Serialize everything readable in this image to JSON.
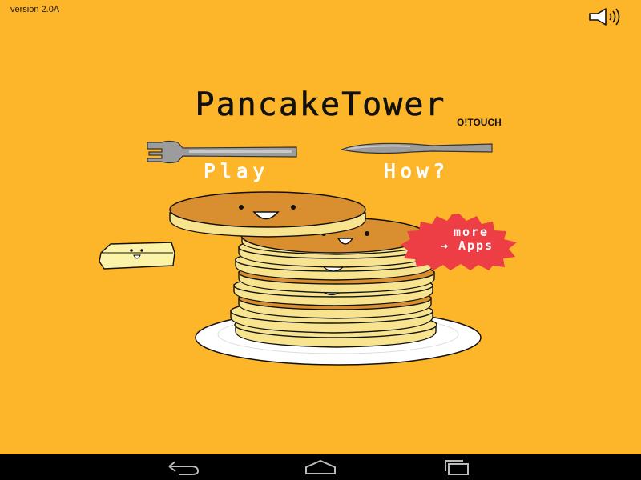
{
  "header": {
    "version": "version 2.0A",
    "sound_icon": "speaker-icon"
  },
  "title": {
    "main": "PancakeTower",
    "brand": "O!TOUCH"
  },
  "menu": {
    "play_label": "Play",
    "how_label": "How?",
    "play_icon": "fork-icon",
    "how_icon": "knife-icon"
  },
  "promo": {
    "line1": "more",
    "line2": "Apps",
    "arrow": "→"
  },
  "navbar": {
    "back_icon": "back-icon",
    "home_icon": "home-icon",
    "recents_icon": "recents-icon"
  },
  "colors": {
    "background": "#FDB52A",
    "pancake": "#F8E48E",
    "pancake_top": "#D98E2F",
    "promo_badge": "#EE3E45"
  }
}
